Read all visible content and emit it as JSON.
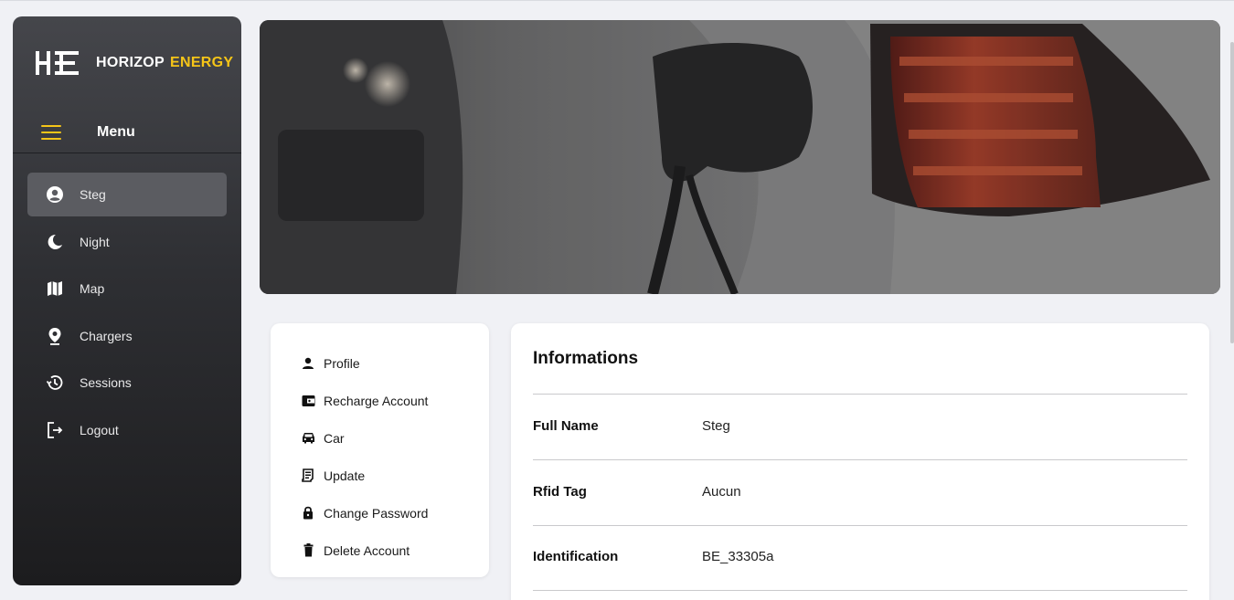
{
  "brand": {
    "name_part1": "HORIZOP",
    "name_part2": "ENERGY",
    "accent": "#f5c518"
  },
  "menu": {
    "label": "Menu"
  },
  "sidebar": {
    "items": [
      {
        "label": "Steg",
        "icon": "user-circle-icon",
        "active": true
      },
      {
        "label": "Night",
        "icon": "moon-icon"
      },
      {
        "label": "Map",
        "icon": "map-icon"
      },
      {
        "label": "Chargers",
        "icon": "location-pin-icon"
      },
      {
        "label": "Sessions",
        "icon": "history-icon"
      },
      {
        "label": "Logout",
        "icon": "logout-icon"
      }
    ]
  },
  "options": {
    "items": [
      {
        "label": "Profile",
        "icon": "person-icon"
      },
      {
        "label": "Recharge Account",
        "icon": "wallet-icon"
      },
      {
        "label": "Car",
        "icon": "car-icon"
      },
      {
        "label": "Update",
        "icon": "receipt-icon"
      },
      {
        "label": "Change Password",
        "icon": "lock-icon"
      },
      {
        "label": "Delete Account",
        "icon": "trash-icon"
      }
    ]
  },
  "info": {
    "title": "Informations",
    "rows": [
      {
        "key": "Full Name",
        "value": "Steg"
      },
      {
        "key": "Rfid Tag",
        "value": "Aucun"
      },
      {
        "key": "Identification",
        "value": "BE_33305a"
      }
    ]
  }
}
